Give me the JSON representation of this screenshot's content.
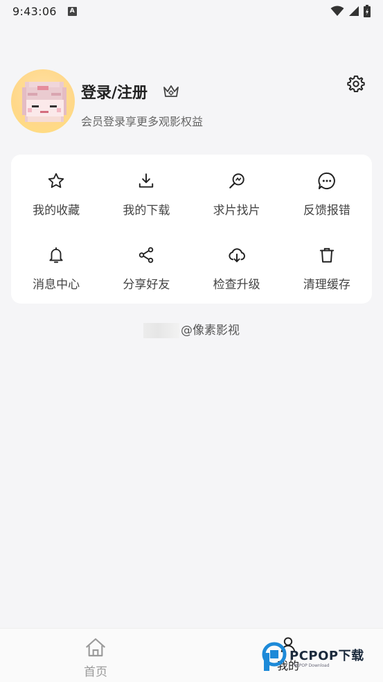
{
  "status_bar": {
    "time": "9:43:06",
    "notification_icon": "a-badge-icon"
  },
  "profile": {
    "title": "登录/注册",
    "subtitle": "会员登录享更多观影权益"
  },
  "grid": {
    "items": [
      {
        "label": "我的收藏",
        "icon": "star-icon"
      },
      {
        "label": "我的下载",
        "icon": "download-icon"
      },
      {
        "label": "求片找片",
        "icon": "search-film-icon"
      },
      {
        "label": "反馈报错",
        "icon": "feedback-icon"
      },
      {
        "label": "消息中心",
        "icon": "bell-icon"
      },
      {
        "label": "分享好友",
        "icon": "share-icon"
      },
      {
        "label": "检查升级",
        "icon": "cloud-download-icon"
      },
      {
        "label": "清理缓存",
        "icon": "trash-icon"
      }
    ]
  },
  "footer": {
    "text": "@像素影视"
  },
  "bottom_nav": {
    "home_label": "首页",
    "mine_label": "我的"
  },
  "watermark": {
    "brand": "PCPOP下载",
    "sub": "PCPOP Download"
  },
  "colors": {
    "background": "#f5f5f7",
    "card": "#ffffff",
    "avatar_bg": "#ffd88a"
  }
}
